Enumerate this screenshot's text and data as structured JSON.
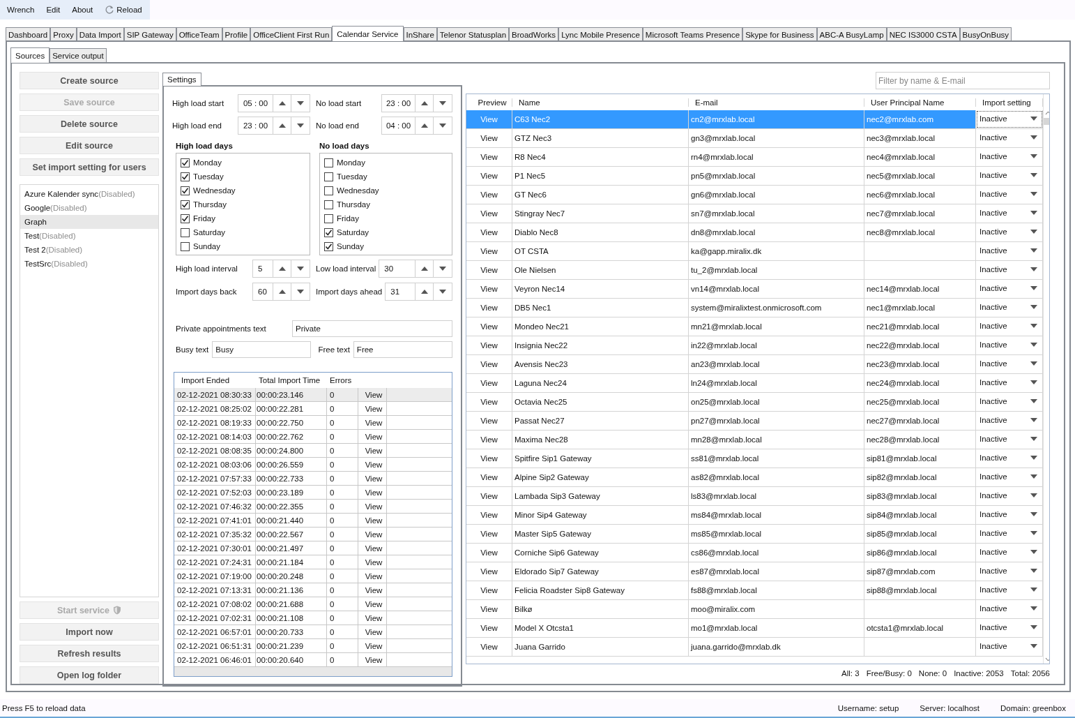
{
  "menu": {
    "items": [
      "Wrench",
      "Edit",
      "About"
    ],
    "reload": "Reload"
  },
  "tabs": [
    {
      "label": "Dashboard",
      "selected": false
    },
    {
      "label": "Proxy",
      "selected": false
    },
    {
      "label": "Data Import",
      "selected": false
    },
    {
      "label": "SIP Gateway",
      "selected": false
    },
    {
      "label": "OfficeTeam",
      "selected": false
    },
    {
      "label": "Profile",
      "selected": false
    },
    {
      "label": "OfficeClient First Run",
      "selected": false
    },
    {
      "label": "Calendar Service",
      "selected": true
    },
    {
      "label": "InShare",
      "selected": false
    },
    {
      "label": "Telenor Statusplan",
      "selected": false
    },
    {
      "label": "BroadWorks",
      "selected": false
    },
    {
      "label": "Lync Mobile Presence",
      "selected": false
    },
    {
      "label": "Microsoft Teams Presence",
      "selected": false
    },
    {
      "label": "Skype for Business",
      "selected": false
    },
    {
      "label": "ABC-A BusyLamp",
      "selected": false
    },
    {
      "label": "NEC IS3000 CSTA",
      "selected": false
    },
    {
      "label": "BusyOnBusy",
      "selected": false
    }
  ],
  "subtabs": [
    {
      "label": "Sources",
      "selected": true
    },
    {
      "label": "Service output",
      "selected": false
    }
  ],
  "source_buttons": [
    {
      "label": "Create source",
      "disabled": false
    },
    {
      "label": "Save source",
      "disabled": true
    },
    {
      "label": "Delete source",
      "disabled": false
    },
    {
      "label": "Edit source",
      "disabled": false
    },
    {
      "label": "Set import setting for users",
      "disabled": false
    }
  ],
  "sources": [
    {
      "name": "Azure Kalender sync",
      "status": "(Disabled)",
      "selected": false
    },
    {
      "name": "Google",
      "status": "(Disabled)",
      "selected": false
    },
    {
      "name": "Graph",
      "selected": true
    },
    {
      "name": "Test",
      "status": "(Disabled)",
      "selected": false
    },
    {
      "name": "Test 2",
      "status": "(Disabled)",
      "selected": false
    },
    {
      "name": "TestSrc",
      "status": "(Disabled)",
      "selected": false
    }
  ],
  "service_buttons": [
    {
      "label": "Start service",
      "disabled": true,
      "shield": true
    },
    {
      "label": "Import now",
      "disabled": false,
      "shield": false
    },
    {
      "label": "Refresh results",
      "disabled": false,
      "shield": false
    },
    {
      "label": "Open log folder",
      "disabled": false,
      "shield": false
    }
  ],
  "settings": {
    "tab": "Settings",
    "time_fields": [
      {
        "label": "High load start",
        "value": "05 : 00"
      },
      {
        "label": "No load start",
        "value": "23 : 00"
      },
      {
        "label": "High load end",
        "value": "23 : 00"
      },
      {
        "label": "No load end",
        "value": "04 : 00"
      }
    ],
    "day_groups": [
      {
        "title": "High load days",
        "days": [
          {
            "label": "Monday",
            "checked": true
          },
          {
            "label": "Tuesday",
            "checked": true
          },
          {
            "label": "Wednesday",
            "checked": true
          },
          {
            "label": "Thursday",
            "checked": true
          },
          {
            "label": "Friday",
            "checked": true
          },
          {
            "label": "Saturday",
            "checked": false
          },
          {
            "label": "Sunday",
            "checked": false
          }
        ]
      },
      {
        "title": "No load days",
        "days": [
          {
            "label": "Monday",
            "checked": false
          },
          {
            "label": "Tuesday",
            "checked": false
          },
          {
            "label": "Wednesday",
            "checked": false
          },
          {
            "label": "Thursday",
            "checked": false
          },
          {
            "label": "Friday",
            "checked": false
          },
          {
            "label": "Saturday",
            "checked": true
          },
          {
            "label": "Sunday",
            "checked": true
          }
        ]
      }
    ],
    "number_fields": [
      {
        "label": "High load interval",
        "value": "5"
      },
      {
        "label": "Low load interval",
        "value": "30"
      },
      {
        "label": "Import days back",
        "value": "60"
      },
      {
        "label": "Import days ahead",
        "value": "31"
      }
    ],
    "private_text": {
      "label": "Private appointments text",
      "value": "Private"
    },
    "busy_text": {
      "label": "Busy text",
      "value": "Busy"
    },
    "free_text": {
      "label": "Free text",
      "value": "Free"
    }
  },
  "import_log": {
    "columns": [
      "Import Ended",
      "Total Import Time",
      "Errors"
    ],
    "rows": [
      {
        "ended": "02-12-2021 08:30:33",
        "time": "00:00:23.146",
        "errors": "0",
        "action": "View",
        "selected": true
      },
      {
        "ended": "02-12-2021 08:25:02",
        "time": "00:00:22.281",
        "errors": "0",
        "action": "View",
        "selected": false
      },
      {
        "ended": "02-12-2021 08:19:33",
        "time": "00:00:22.750",
        "errors": "0",
        "action": "View",
        "selected": false
      },
      {
        "ended": "02-12-2021 08:14:03",
        "time": "00:00:22.762",
        "errors": "0",
        "action": "View",
        "selected": false
      },
      {
        "ended": "02-12-2021 08:08:35",
        "time": "00:00:24.800",
        "errors": "0",
        "action": "View",
        "selected": false
      },
      {
        "ended": "02-12-2021 08:03:06",
        "time": "00:00:26.559",
        "errors": "0",
        "action": "View",
        "selected": false
      },
      {
        "ended": "02-12-2021 07:57:33",
        "time": "00:00:22.733",
        "errors": "0",
        "action": "View",
        "selected": false
      },
      {
        "ended": "02-12-2021 07:52:03",
        "time": "00:00:23.189",
        "errors": "0",
        "action": "View",
        "selected": false
      },
      {
        "ended": "02-12-2021 07:46:32",
        "time": "00:00:22.355",
        "errors": "0",
        "action": "View",
        "selected": false
      },
      {
        "ended": "02-12-2021 07:41:01",
        "time": "00:00:21.440",
        "errors": "0",
        "action": "View",
        "selected": false
      },
      {
        "ended": "02-12-2021 07:35:32",
        "time": "00:00:22.567",
        "errors": "0",
        "action": "View",
        "selected": false
      },
      {
        "ended": "02-12-2021 07:30:01",
        "time": "00:00:21.497",
        "errors": "0",
        "action": "View",
        "selected": false
      },
      {
        "ended": "02-12-2021 07:24:31",
        "time": "00:00:21.184",
        "errors": "0",
        "action": "View",
        "selected": false
      },
      {
        "ended": "02-12-2021 07:19:00",
        "time": "00:00:20.248",
        "errors": "0",
        "action": "View",
        "selected": false
      },
      {
        "ended": "02-12-2021 07:13:31",
        "time": "00:00:21.136",
        "errors": "0",
        "action": "View",
        "selected": false
      },
      {
        "ended": "02-12-2021 07:08:02",
        "time": "00:00:21.688",
        "errors": "0",
        "action": "View",
        "selected": false
      },
      {
        "ended": "02-12-2021 07:02:31",
        "time": "00:00:21.108",
        "errors": "0",
        "action": "View",
        "selected": false
      },
      {
        "ended": "02-12-2021 06:57:01",
        "time": "00:00:20.733",
        "errors": "0",
        "action": "View",
        "selected": false
      },
      {
        "ended": "02-12-2021 06:51:31",
        "time": "00:00:21.239",
        "errors": "0",
        "action": "View",
        "selected": false
      },
      {
        "ended": "02-12-2021 06:46:01",
        "time": "00:00:20.640",
        "errors": "0",
        "action": "View",
        "selected": false
      }
    ]
  },
  "users": {
    "filter_placeholder": "Filter by name & E-mail",
    "columns": [
      "Preview",
      "Name",
      "E-mail",
      "User Principal Name",
      "Import setting"
    ],
    "rows": [
      {
        "preview": "View",
        "name": "C63 Nec2",
        "email": "cn2@mrxlab.local",
        "upn": "nec2@mrxlab.com",
        "setting": "Inactive",
        "selected": true
      },
      {
        "preview": "View",
        "name": "GTZ Nec3",
        "email": "gn3@mrxlab.local",
        "upn": "nec3@mrxlab.local",
        "setting": "Inactive",
        "selected": false
      },
      {
        "preview": "View",
        "name": "R8 Nec4",
        "email": "rn4@mrxlab.local",
        "upn": "nec4@mrxlab.local",
        "setting": "Inactive",
        "selected": false
      },
      {
        "preview": "View",
        "name": "P1 Nec5",
        "email": "pn5@mrxlab.local",
        "upn": "nec5@mrxlab.local",
        "setting": "Inactive",
        "selected": false
      },
      {
        "preview": "View",
        "name": "GT Nec6",
        "email": "gn6@mrxlab.local",
        "upn": "nec6@mrxlab.local",
        "setting": "Inactive",
        "selected": false
      },
      {
        "preview": "View",
        "name": "Stingray Nec7",
        "email": "sn7@mrxlab.local",
        "upn": "nec7@mrxlab.local",
        "setting": "Inactive",
        "selected": false
      },
      {
        "preview": "View",
        "name": "Diablo Nec8",
        "email": "dn8@mrxlab.local",
        "upn": "nec8@mrxlab.local",
        "setting": "Inactive",
        "selected": false
      },
      {
        "preview": "View",
        "name": "OT CSTA",
        "email": "ka@gapp.miralix.dk",
        "setting": "Inactive",
        "selected": false
      },
      {
        "preview": "View",
        "name": "Ole Nielsen",
        "email": "tu_2@mrxlab.local",
        "setting": "Inactive",
        "selected": false
      },
      {
        "preview": "View",
        "name": "Veyron Nec14",
        "email": "vn14@mrxlab.local",
        "upn": "nec14@mrxlab.local",
        "setting": "Inactive",
        "selected": false
      },
      {
        "preview": "View",
        "name": "DB5 Nec1",
        "email": "system@miralixtest.onmicrosoft.com",
        "upn": "nec1@mrxlab.local",
        "setting": "Inactive",
        "selected": false
      },
      {
        "preview": "View",
        "name": "Mondeo Nec21",
        "email": "mn21@mrxlab.local",
        "upn": "nec21@mrxlab.local",
        "setting": "Inactive",
        "selected": false
      },
      {
        "preview": "View",
        "name": "Insignia Nec22",
        "email": "in22@mrxlab.local",
        "upn": "nec22@mrxlab.local",
        "setting": "Inactive",
        "selected": false
      },
      {
        "preview": "View",
        "name": "Avensis Nec23",
        "email": "an23@mrxlab.local",
        "upn": "nec23@mrxlab.local",
        "setting": "Inactive",
        "selected": false
      },
      {
        "preview": "View",
        "name": "Laguna Nec24",
        "email": "ln24@mrxlab.local",
        "upn": "nec24@mrxlab.local",
        "setting": "Inactive",
        "selected": false
      },
      {
        "preview": "View",
        "name": "Octavia Nec25",
        "email": "on25@mrxlab.local",
        "upn": "nec25@mrxlab.local",
        "setting": "Inactive",
        "selected": false
      },
      {
        "preview": "View",
        "name": "Passat Nec27",
        "email": "pn27@mrxlab.local",
        "upn": "nec27@mrxlab.local",
        "setting": "Inactive",
        "selected": false
      },
      {
        "preview": "View",
        "name": "Maxima Nec28",
        "email": "mn28@mrxlab.local",
        "upn": "nec28@mrxlab.local",
        "setting": "Inactive",
        "selected": false
      },
      {
        "preview": "View",
        "name": "Spitfire Sip1 Gateway",
        "email": "ss81@mrxlab.local",
        "upn": "sip81@mrxlab.local",
        "setting": "Inactive",
        "selected": false
      },
      {
        "preview": "View",
        "name": "Alpine Sip2 Gateway",
        "email": "as82@mrxlab.local",
        "upn": "sip82@mrxlab.local",
        "setting": "Inactive",
        "selected": false
      },
      {
        "preview": "View",
        "name": "Lambada Sip3 Gateway",
        "email": "ls83@mrxlab.local",
        "upn": "sip83@mrxlab.local",
        "setting": "Inactive",
        "selected": false
      },
      {
        "preview": "View",
        "name": "Minor Sip4 Gateway",
        "email": "ms84@mrxlab.local",
        "upn": "sip84@mrxlab.local",
        "setting": "Inactive",
        "selected": false
      },
      {
        "preview": "View",
        "name": "Master Sip5 Gateway",
        "email": "ms85@mrxlab.local",
        "upn": "sip85@mrxlab.local",
        "setting": "Inactive",
        "selected": false
      },
      {
        "preview": "View",
        "name": "Corniche Sip6 Gateway",
        "email": "cs86@mrxlab.local",
        "upn": "sip86@mrxlab.local",
        "setting": "Inactive",
        "selected": false
      },
      {
        "preview": "View",
        "name": "Eldorado Sip7 Gateway",
        "email": "es87@mrxlab.local",
        "upn": "sip87@mrxlab.com",
        "setting": "Inactive",
        "selected": false
      },
      {
        "preview": "View",
        "name": "Felicia Roadster Sip8 Gateway",
        "email": "fs88@mrxlab.local",
        "upn": "sip88@mrxlab.local",
        "setting": "Inactive",
        "selected": false
      },
      {
        "preview": "View",
        "name": "Bilkø",
        "email": "moo@miralix.com",
        "setting": "Inactive",
        "selected": false
      },
      {
        "preview": "View",
        "name": "Model X Otcsta1",
        "email": "mo1@mrxlab.local",
        "upn": "otcsta1@mrxlab.local",
        "setting": "Inactive",
        "selected": false
      },
      {
        "preview": "View",
        "name": "Juana Garrido",
        "email": "juana.garrido@mrxlab.dk",
        "setting": "Inactive",
        "selected": false
      }
    ],
    "summary": [
      "All: 3",
      "Free/Busy: 0",
      "None: 0",
      "Inactive: 2053",
      "Total: 2056"
    ]
  },
  "status_bar": {
    "hint": "Press F5 to reload data",
    "items": [
      "Username: setup",
      "Server: localhost",
      "Domain: greenbox"
    ]
  }
}
